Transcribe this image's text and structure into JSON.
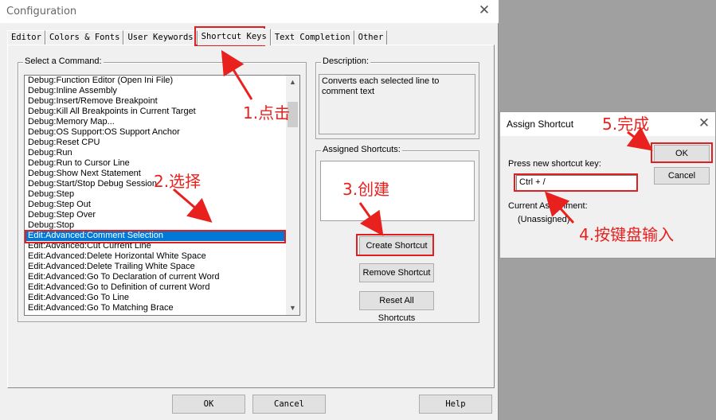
{
  "window": {
    "title": "Configuration"
  },
  "tabs": [
    "Editor",
    "Colors & Fonts",
    "User Keywords",
    "Shortcut Keys",
    "Text Completion",
    "Other"
  ],
  "select_command": {
    "label": "Select a Command:",
    "items": [
      "Debug:Function Editor (Open Ini File)",
      "Debug:Inline Assembly",
      "Debug:Insert/Remove Breakpoint",
      "Debug:Kill All Breakpoints in Current Target",
      "Debug:Memory Map...",
      "Debug:OS Support:OS Support Anchor",
      "Debug:Reset CPU",
      "Debug:Run",
      "Debug:Run to Cursor Line",
      "Debug:Show Next Statement",
      "Debug:Start/Stop Debug Session",
      "Debug:Step",
      "Debug:Step Out",
      "Debug:Step Over",
      "Debug:Stop",
      "Edit:Advanced:Comment Selection",
      "Edit:Advanced:Cut Current Line",
      "Edit:Advanced:Delete Horizontal White Space",
      "Edit:Advanced:Delete Trailing White Space",
      "Edit:Advanced:Go To Declaration of current Word",
      "Edit:Advanced:Go to Definition of current Word",
      "Edit:Advanced:Go To Line",
      "Edit:Advanced:Go To Matching Brace"
    ]
  },
  "description": {
    "label": "Description:",
    "text": "Converts each selected line to comment text"
  },
  "assigned": {
    "label": "Assigned Shortcuts:"
  },
  "buttons": {
    "create": "Create Shortcut",
    "remove": "Remove Shortcut",
    "reset": "Reset All Shortcuts",
    "ok": "OK",
    "cancel": "Cancel",
    "help": "Help"
  },
  "assign_dialog": {
    "title": "Assign Shortcut",
    "press_label": "Press new shortcut key:",
    "key_value": "Ctrl + /",
    "current_label": "Current Assignment:",
    "current_value": "(Unassigned)",
    "ok": "OK",
    "cancel": "Cancel"
  },
  "annotations": {
    "a1": "1.点击",
    "a2": "2.选择",
    "a3": "3.创建",
    "a4": "4.按键盘输入",
    "a5": "5.完成"
  },
  "colors": {
    "selection": "#0078d7",
    "annotation": "#e8211f"
  },
  "icons": {
    "close": "close-icon",
    "scroll_up": "chevron-up-icon",
    "scroll_down": "chevron-down-icon"
  }
}
